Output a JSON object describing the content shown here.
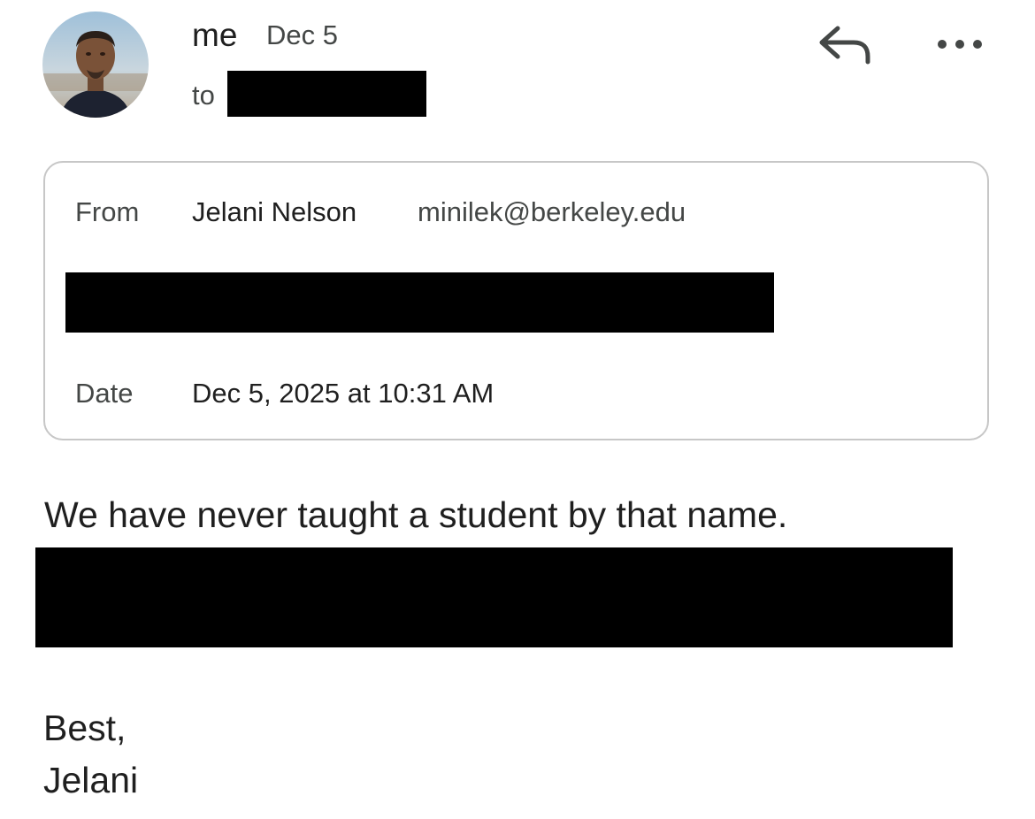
{
  "header": {
    "sender": "me",
    "date": "Dec 5",
    "to_label": "to"
  },
  "actions": {
    "reply_icon": "reply-icon",
    "more_icon": "more-horizontal-icon"
  },
  "details": {
    "from_label": "From",
    "from_name": "Jelani Nelson",
    "from_email": "minilek@berkeley.edu",
    "date_label": "Date",
    "date_value": "Dec 5, 2025 at 10:31 AM"
  },
  "message": {
    "line1": "We have never taught a student by that name.",
    "closing": "Best,",
    "signature": "Jelani"
  },
  "colors": {
    "primary_text": "#1f1f1f",
    "secondary_text": "#444746",
    "card_border": "#c7c7c7",
    "redaction": "#000000"
  }
}
